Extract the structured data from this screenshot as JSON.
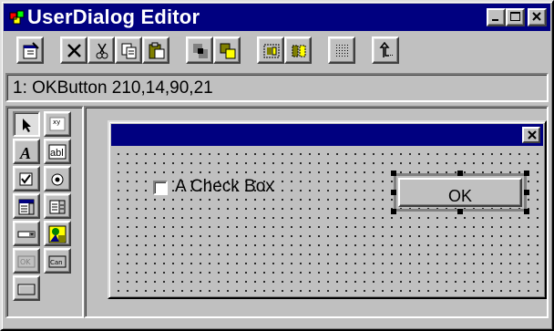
{
  "window": {
    "title": "UserDialog Editor",
    "controls": [
      "minimize-icon",
      "maximize-icon",
      "close-icon"
    ]
  },
  "toolbar": {
    "tools": [
      "properties",
      "delete",
      "cut",
      "copy",
      "paste",
      "send-to-back",
      "bring-to-front",
      "group",
      "ungroup",
      "grid",
      "exit"
    ]
  },
  "status": {
    "text": "1: OKButton 210,14,90,21"
  },
  "toolbox": {
    "tools": [
      "pointer",
      "caption-text",
      "text",
      "text-box",
      "check-box",
      "option-button",
      "list-box",
      "combo-box",
      "drop-list-box",
      "picture",
      "ok-button",
      "cancel-button",
      "push-button"
    ],
    "ok_label": "OK",
    "cancel_label": "Can"
  },
  "dialog": {
    "checkbox_label": "A Check Box",
    "ok_button_label": "OK"
  },
  "colors": {
    "face": "#c0c0c0",
    "title_bar": "#000080",
    "highlight": "#ffffff",
    "shadow": "#808080"
  }
}
